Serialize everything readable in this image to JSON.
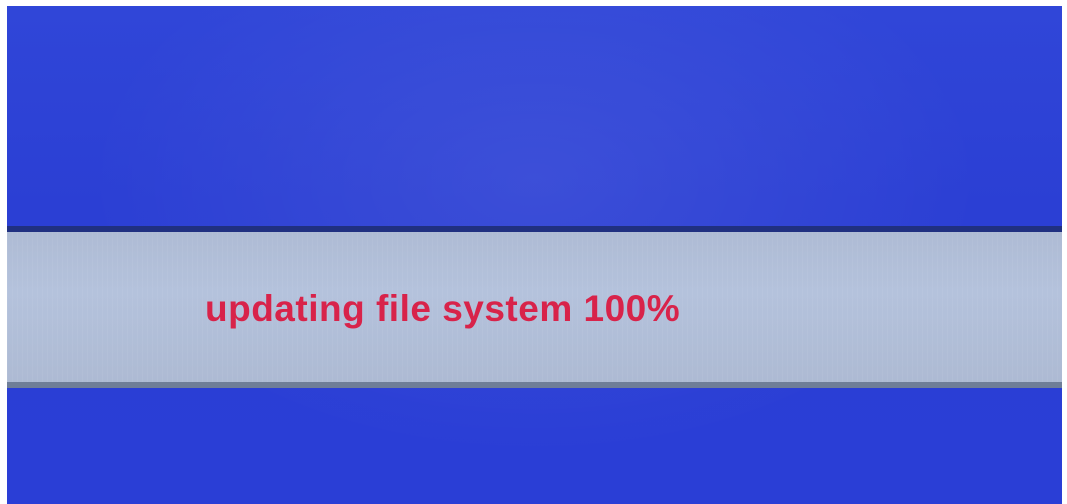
{
  "status": {
    "message": "updating file system 100%",
    "progress_percent": 100
  },
  "colors": {
    "background": "#2b3fd4",
    "banner": "#b0bdd6",
    "text": "#d8234a"
  }
}
